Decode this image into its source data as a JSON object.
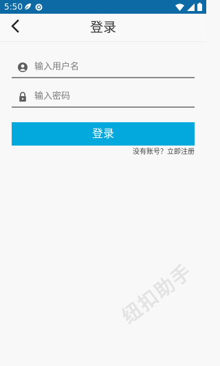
{
  "status_bar": {
    "time": "5:50",
    "background_color": "#0e6aa5",
    "left_icons": [
      "leaf-icon",
      "sync-icon"
    ],
    "right_icons": [
      "wifi-icon",
      "cellular-signal-icon",
      "battery-icon"
    ]
  },
  "app_bar": {
    "title": "登录",
    "back_icon": "chevron-left-icon"
  },
  "form": {
    "username": {
      "placeholder": "输入用户名",
      "value": "",
      "icon": "account-circle-icon"
    },
    "password": {
      "placeholder": "输入密码",
      "value": "",
      "icon": "lock-icon"
    },
    "login_button_label": "登录",
    "register_link": "没有账号？立即注册"
  },
  "colors": {
    "primary_button": "#03a9dd",
    "field_underline": "#8a8a8a",
    "page_background": "#f8f8f8"
  },
  "watermark": "纽扣助手"
}
